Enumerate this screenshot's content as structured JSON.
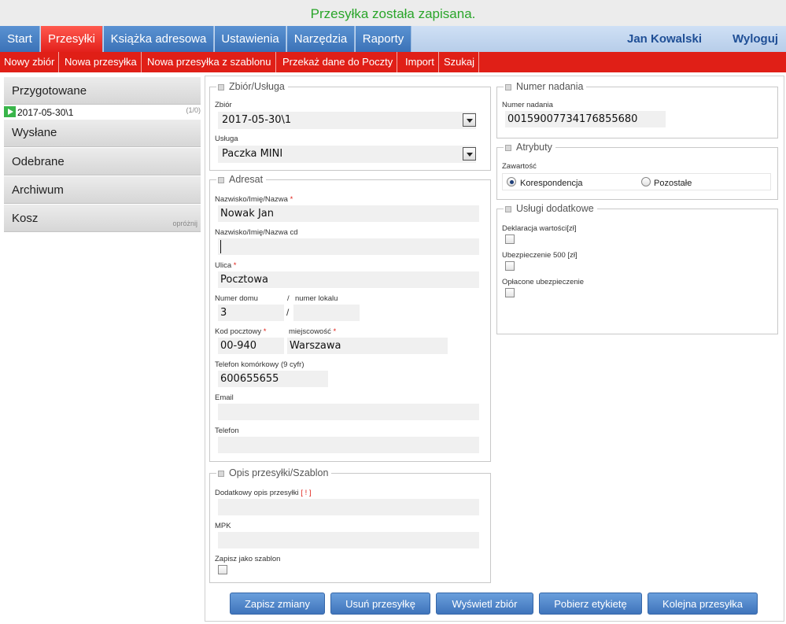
{
  "status": {
    "message": "Przesyłka została zapisana."
  },
  "nav": {
    "tabs": [
      {
        "label": "Start"
      },
      {
        "label": "Przesyłki"
      },
      {
        "label": "Książka adresowa"
      },
      {
        "label": "Ustawienia"
      },
      {
        "label": "Narzędzia"
      },
      {
        "label": "Raporty"
      }
    ],
    "active_tab": "Przesyłki",
    "user": "Jan Kowalski",
    "logout": "Wyloguj"
  },
  "subnav": {
    "items": [
      {
        "label": "Nowy zbiór"
      },
      {
        "label": "Nowa przesyłka"
      },
      {
        "label": "Nowa przesyłka z szablonu"
      },
      {
        "label": "Przekaż dane do Poczty"
      },
      {
        "label": "Import"
      },
      {
        "label": "Szukaj"
      }
    ]
  },
  "sidebar": {
    "sections": [
      {
        "label": "Przygotowane"
      },
      {
        "label": "Wysłane"
      },
      {
        "label": "Odebrane"
      },
      {
        "label": "Archiwum"
      },
      {
        "label": "Kosz"
      }
    ],
    "subitem": {
      "date": "2017-05-30\\1",
      "count": "(1/0)"
    },
    "empty_link": "opróżnij"
  },
  "form": {
    "zbior_usluga": {
      "legend": "Zbiór/Usługa",
      "zbior_label": "Zbiór",
      "zbior_value": "2017-05-30\\1",
      "usluga_label": "Usługa",
      "usluga_value": "Paczka MINI"
    },
    "adresat": {
      "legend": "Adresat",
      "name_label": "Nazwisko/Imię/Nazwa",
      "name_value": "Nowak Jan",
      "name_cd_label": "Nazwisko/Imię/Nazwa cd",
      "name_cd_value": "",
      "street_label": "Ulica",
      "street_value": "Pocztowa",
      "house_label": "Numer domu",
      "house_value": "3",
      "slash": "/",
      "flat_label": "numer lokalu",
      "flat_value": "",
      "postcode_label": "Kod pocztowy",
      "postcode_value": "00-940",
      "city_label": "miejscowość",
      "city_value": "Warszawa",
      "mobile_label": "Telefon komórkowy (9 cyfr)",
      "mobile_value": "600655655",
      "email_label": "Email",
      "email_value": "",
      "phone_label": "Telefon",
      "phone_value": "",
      "required_mark": "*"
    },
    "opis": {
      "legend": "Opis przesyłki/Szablon",
      "extra_label": "Dodatkowy opis przesyłki",
      "extra_mark": "[ ! ]",
      "extra_value": "",
      "mpk_label": "MPK",
      "mpk_value": "",
      "template_label": "Zapisz jako szablon"
    },
    "numer": {
      "legend": "Numer nadania",
      "label": "Numer nadania",
      "value": "00159007734176855680"
    },
    "atrybuty": {
      "legend": "Atrybuty",
      "content_label": "Zawartość",
      "options": [
        {
          "label": "Korespondencja"
        },
        {
          "label": "Pozostałe"
        }
      ],
      "selected": "Korespondencja"
    },
    "dodatkowe": {
      "legend": "Usługi dodatkowe",
      "items": [
        {
          "label": "Deklaracja wartości[zł]"
        },
        {
          "label": "Ubezpieczenie 500 [zł]"
        },
        {
          "label": "Opłacone ubezpieczenie"
        }
      ]
    }
  },
  "buttons": {
    "save": "Zapisz zmiany",
    "delete": "Usuń przesyłkę",
    "show_set": "Wyświetl zbiór",
    "label": "Pobierz etykietę",
    "next": "Kolejna przesyłka"
  },
  "colors": {
    "nav_blue": "#3b72b7",
    "nav_red": "#e3201b",
    "subnav_red": "#e01f17",
    "status_green": "#2aa52a",
    "user_blue": "#1f4f96"
  }
}
